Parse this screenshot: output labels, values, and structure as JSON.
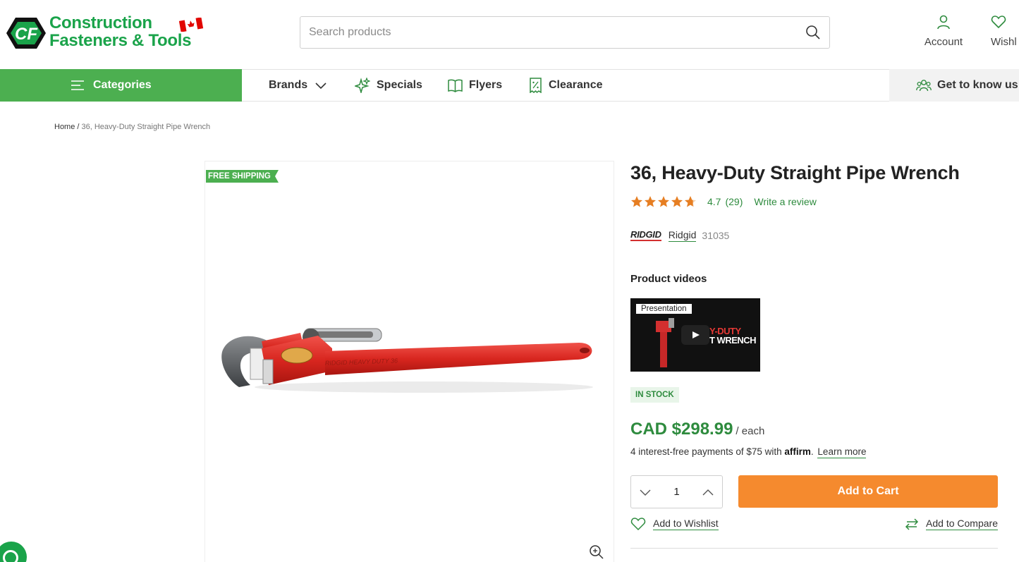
{
  "header": {
    "logo_line1": "Construction",
    "logo_line2": "Fasteners & Tools",
    "logo_badge": "CF",
    "search_placeholder": "Search products",
    "account_label": "Account",
    "wishlist_label": "Wishl"
  },
  "nav": {
    "categories_label": "Categories",
    "items": [
      {
        "label": "Brands",
        "icon": "chevron-down-icon"
      },
      {
        "label": "Specials",
        "icon": "sparkle-icon"
      },
      {
        "label": "Flyers",
        "icon": "book-icon"
      },
      {
        "label": "Clearance",
        "icon": "receipt-icon"
      }
    ],
    "know_us_label": "Get to know us"
  },
  "breadcrumb": {
    "home": "Home",
    "separator": " / ",
    "current": "36, Heavy-Duty Straight Pipe Wrench"
  },
  "product": {
    "badge": "FREE SHIPPING",
    "title": "36, Heavy-Duty Straight Pipe Wrench",
    "rating_value": "4.7",
    "rating_stars": 4.7,
    "rating_count": "(29)",
    "write_review": "Write a review",
    "brand_logo_text": "RIDGID",
    "brand_name": "Ridgid",
    "sku": "31035",
    "videos_title": "Product videos",
    "video_label": "Presentation",
    "video_text_line1": "Y-DUTY",
    "video_text_line2": "T WRENCH",
    "stock": "IN STOCK",
    "price": "CAD $298.99",
    "unit": "/ each",
    "affirm_text": "4 interest-free payments of $75 with ",
    "affirm_logo": "affirm",
    "affirm_period": ".",
    "learn_more": "Learn more",
    "quantity": "1",
    "add_to_cart": "Add to Cart",
    "add_to_wishlist": "Add to Wishlist",
    "add_to_compare": "Add to Compare"
  },
  "colors": {
    "brand_green": "#1aa34a",
    "nav_green": "#4caf50",
    "price_green": "#2e8b3e",
    "cart_orange": "#f58a2e",
    "star_orange": "#e67e22"
  }
}
